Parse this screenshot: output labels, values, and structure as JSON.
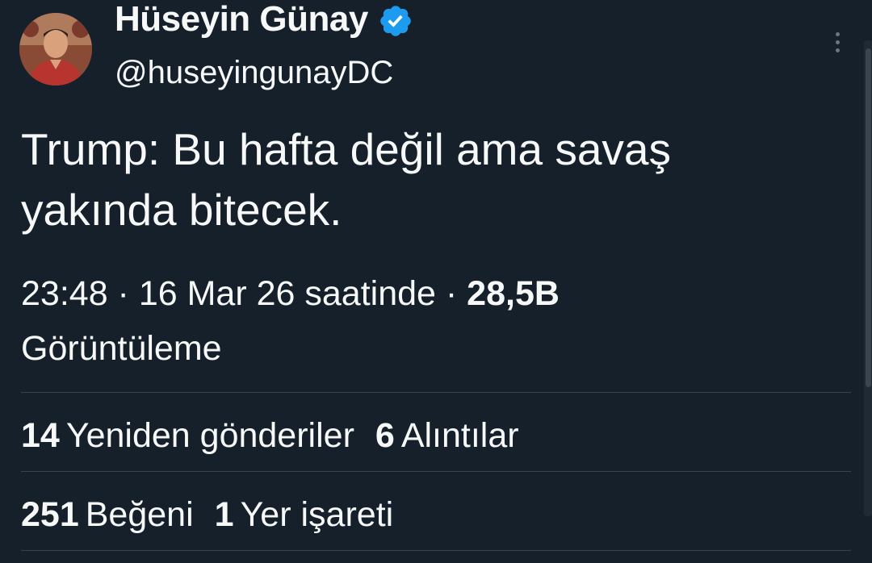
{
  "author": {
    "display_name": "Hüseyin Günay",
    "handle": "@huseyingunayDC",
    "verified": true,
    "verified_color": "#1d9bf0"
  },
  "tweet": {
    "text": "Trump: Bu hafta değil ama savaş yakında bitecek."
  },
  "meta": {
    "time": "23:48",
    "separator": " · ",
    "date_text": "16 Mar 26 saatinde",
    "views_count": "28,5B",
    "views_label": "Görüntüleme"
  },
  "stats": {
    "retweets_count": "14",
    "retweets_label": "Yeniden gönderiler",
    "quotes_count": "6",
    "quotes_label": "Alıntılar",
    "likes_count": "251",
    "likes_label": "Beğeni",
    "bookmarks_count": "1",
    "bookmarks_label": "Yer işareti"
  },
  "colors": {
    "background": "#15202b",
    "text": "#f7f9f9",
    "divider": "#38444d"
  },
  "icons": {
    "verified": "verified-badge-icon",
    "more": "more-options-icon"
  }
}
